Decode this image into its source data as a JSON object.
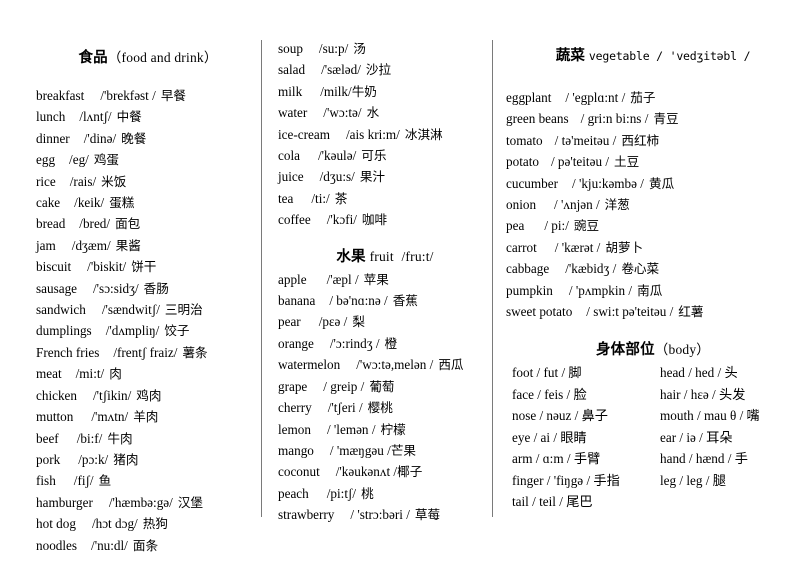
{
  "document": {
    "type": "vocabulary-word-list",
    "columns": 3
  },
  "sections": {
    "food": {
      "title_cjk": "食品",
      "title_latin": "（food and drink）",
      "entries": [
        {
          "word": "breakfast",
          "phonetic": "/'brekfəst /",
          "chinese": "早餐",
          "gap": 16
        },
        {
          "word": "lunch",
          "phonetic": "/lʌntʃ/",
          "chinese": "中餐",
          "gap": 14
        },
        {
          "word": "dinner",
          "phonetic": "/'dinə/",
          "chinese": "晚餐",
          "gap": 14
        },
        {
          "word": "egg",
          "phonetic": "/eg/",
          "chinese": "鸡蛋",
          "gap": 14
        },
        {
          "word": "rice",
          "phonetic": "/rais/",
          "chinese": "米饭",
          "gap": 14
        },
        {
          "word": "cake",
          "phonetic": "/keik/",
          "chinese": "蛋糕",
          "gap": 14
        },
        {
          "word": "bread",
          "phonetic": "/bred/",
          "chinese": "面包",
          "gap": 14
        },
        {
          "word": "jam",
          "phonetic": "/dʒæm/",
          "chinese": "果酱",
          "gap": 16
        },
        {
          "word": "biscuit",
          "phonetic": "/'biskit/",
          "chinese": "饼干",
          "gap": 16
        },
        {
          "word": "sausage",
          "phonetic": "/'sɔ:sidʒ/",
          "chinese": "香肠",
          "gap": 16
        },
        {
          "word": "sandwich",
          "phonetic": "/'sændwitʃ/",
          "chinese": "三明治",
          "gap": 16
        },
        {
          "word": "dumplings",
          "phonetic": "/'dʌmpliŋ/",
          "chinese": "饺子",
          "gap": 14
        },
        {
          "word": "French fries",
          "phonetic": "/frentʃ fraiz/",
          "chinese": "薯条",
          "gap": 14
        },
        {
          "word": "meat",
          "phonetic": "/mi:t/",
          "chinese": "肉",
          "gap": 14
        },
        {
          "word": "chicken",
          "phonetic": "/'tʃikin/",
          "chinese": "鸡肉",
          "gap": 16
        },
        {
          "word": "mutton",
          "phonetic": "/'mʌtn/",
          "chinese": "羊肉",
          "gap": 18
        },
        {
          "word": "beef",
          "phonetic": "/bi:f/",
          "chinese": "牛肉",
          "gap": 18
        },
        {
          "word": "pork",
          "phonetic": "/pɔ:k/",
          "chinese": "猪肉",
          "gap": 18
        },
        {
          "word": "fish",
          "phonetic": "/fiʃ/",
          "chinese": "鱼",
          "gap": 18
        },
        {
          "word": "hamburger",
          "phonetic": "/'hæmbə:gə/",
          "chinese": "汉堡",
          "gap": 16
        },
        {
          "word": "hot dog",
          "phonetic": "/hɔt dɔg/",
          "chinese": "热狗",
          "gap": 16
        },
        {
          "word": "noodles",
          "phonetic": "/'nu:dl/",
          "chinese": "面条",
          "gap": 14
        }
      ]
    },
    "drinks": {
      "entries": [
        {
          "word": "soup",
          "phonetic": "/su:p/",
          "chinese": "汤",
          "gap": 16
        },
        {
          "word": "salad",
          "phonetic": "/'sæləd/",
          "chinese": "沙拉",
          "gap": 16
        },
        {
          "word": "milk",
          "phonetic": "/milk/",
          "chinese": "牛奶",
          "gap": 18,
          "nospace": true
        },
        {
          "word": "water",
          "phonetic": "/'wɔ:tə/",
          "chinese": "水",
          "gap": 16
        },
        {
          "word": "ice-cream",
          "phonetic": "/ais kri:m/",
          "chinese": "冰淇淋",
          "gap": 16
        },
        {
          "word": "cola",
          "phonetic": "/'kəulə/",
          "chinese": "可乐",
          "gap": 18
        },
        {
          "word": "juice",
          "phonetic": "/dʒu:s/",
          "chinese": "果汁",
          "gap": 16
        },
        {
          "word": "tea",
          "phonetic": "/ti:/",
          "chinese": "茶",
          "gap": 18
        },
        {
          "word": "coffee",
          "phonetic": "/'kɔfi/",
          "chinese": "咖啡",
          "gap": 16
        }
      ]
    },
    "fruit": {
      "title_cjk": "水果",
      "title_latin": "fruit",
      "title_phonetic": "/fru:t/",
      "entries": [
        {
          "word": "apple",
          "phonetic": "/'æpl /",
          "chinese": "苹果",
          "gap": 20
        },
        {
          "word": "banana",
          "phonetic": "/ bə'nɑ:nə /",
          "chinese": "香蕉",
          "gap": 14
        },
        {
          "word": "pear",
          "phonetic": "/pɛə /",
          "chinese": "梨",
          "gap": 18
        },
        {
          "word": "orange",
          "phonetic": "/'ɔ:rindʒ /",
          "chinese": "橙",
          "gap": 16
        },
        {
          "word": "watermelon",
          "phonetic": "/'wɔ:tə,melən /",
          "chinese": "西瓜",
          "gap": 16
        },
        {
          "word": "grape",
          "phonetic": "/ greip /",
          "chinese": "葡萄",
          "gap": 16
        },
        {
          "word": "cherry",
          "phonetic": "/'tʃeri /",
          "chinese": "樱桃",
          "gap": 16
        },
        {
          "word": "lemon",
          "phonetic": "/ 'lemən /",
          "chinese": "柠檬",
          "gap": 16
        },
        {
          "word": "mango",
          "phonetic": "/ 'mæŋgəu /",
          "chinese": "芒果",
          "gap": 16,
          "nospace": true
        },
        {
          "word": "coconut",
          "phonetic": "/'kəukənʌt /",
          "chinese": "椰子",
          "gap": 16,
          "nospace": true
        },
        {
          "word": "peach",
          "phonetic": "/pi:tʃ/",
          "chinese": "桃",
          "gap": 18
        },
        {
          "word": "strawberry",
          "phonetic": "/ 'strɔ:bəri /",
          "chinese": "草莓",
          "gap": 16
        }
      ]
    },
    "vegetable": {
      "title_cjk": "蔬菜",
      "title_mono": "vegetable / 'vedʒitəbl /",
      "entries": [
        {
          "word": "eggplant",
          "phonetic": "/ 'egplɑ:nt /",
          "chinese": "茄子",
          "gap": 14
        },
        {
          "word": "green beans",
          "phonetic": "/ gri:n bi:ns /",
          "chinese": "青豆",
          "gap": 12
        },
        {
          "word": "tomato",
          "phonetic": "/ tə'meitəu /",
          "chinese": "西红柿",
          "gap": 12
        },
        {
          "word": "potato",
          "phonetic": "/ pə'teitəu /",
          "chinese": "土豆",
          "gap": 12
        },
        {
          "word": "cucumber",
          "phonetic": "/ 'kju:kəmbə /",
          "chinese": "黄瓜",
          "gap": 14
        },
        {
          "word": "onion",
          "phonetic": "/ 'ʌnjən /",
          "chinese": "洋葱",
          "gap": 18
        },
        {
          "word": "pea",
          "phonetic": "/ pi:/",
          "chinese": "豌豆",
          "gap": 20
        },
        {
          "word": "carrot",
          "phonetic": "/ 'kærət /",
          "chinese": "胡萝卜",
          "gap": 18
        },
        {
          "word": "cabbage",
          "phonetic": "/'kæbidʒ /",
          "chinese": "卷心菜",
          "gap": 16
        },
        {
          "word": "pumpkin",
          "phonetic": "/ 'pʌmpkin /",
          "chinese": "南瓜",
          "gap": 16
        },
        {
          "word": "sweet potato",
          "phonetic": "/ swi:t pə'teitəu /",
          "chinese": "红薯",
          "gap": 14
        }
      ]
    },
    "body": {
      "title_cjk": "身体部位",
      "title_latin": "（body）",
      "rows": [
        {
          "left": "foot  / fut / 脚",
          "right": "head / hed / 头"
        },
        {
          "left": "face / feis / 脸",
          "right": "hair / hɛə / 头发"
        },
        {
          "left": "nose / nəuz / 鼻子",
          "right": "mouth / mau θ / 嘴"
        },
        {
          "left": "eye / ai / 眼睛",
          "right": "ear / iə / 耳朵"
        },
        {
          "left": "arm / ɑ:m / 手臂",
          "right": "hand / hænd / 手"
        },
        {
          "left": "finger / 'fiŋgə / 手指",
          "right": "leg / leg / 腿"
        },
        {
          "left": "tail / teil / 尾巴",
          "right": ""
        }
      ]
    }
  },
  "colors": {
    "background": "#ffffff",
    "text": "#000000",
    "divider": "#7a7a7a"
  }
}
